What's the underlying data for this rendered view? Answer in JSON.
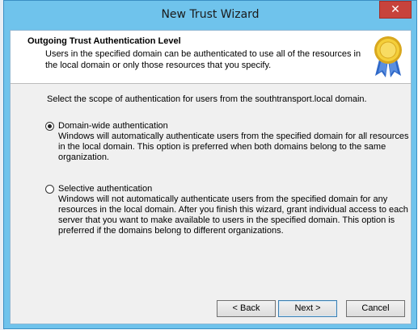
{
  "window": {
    "title": "New Trust Wizard"
  },
  "header": {
    "title": "Outgoing Trust Authentication Level",
    "description": "Users in the specified domain can be authenticated to use all of the resources in the local domain or only those resources that you specify."
  },
  "scope_text": "Select the scope of authentication for users from the southtransport.local domain.",
  "options": [
    {
      "label": "Domain-wide authentication",
      "description": "Windows will automatically authenticate users from the specified domain for all resources in the local domain. This option is preferred when both domains belong to the same organization.",
      "selected": true
    },
    {
      "label": "Selective authentication",
      "description": "Windows will not automatically authenticate users from the specified domain for any resources in the local domain. After you finish this wizard, grant individual access to each server that you want to make available to users in the specified domain. This option is preferred if the domains belong to different organizations.",
      "selected": false
    }
  ],
  "buttons": {
    "back": "< Back",
    "next": "Next >",
    "cancel": "Cancel"
  },
  "icons": {
    "close": "close-icon",
    "header": "award-ribbon-icon"
  },
  "colors": {
    "titlebar": "#6fc3ec",
    "close": "#c7433c"
  }
}
